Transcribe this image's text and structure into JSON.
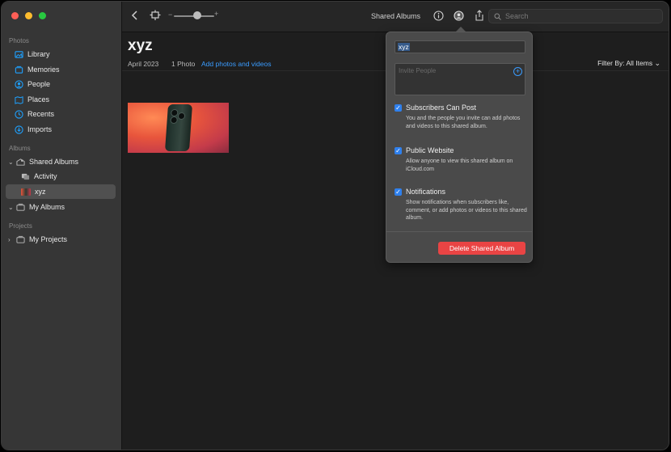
{
  "sidebar": {
    "sections": [
      {
        "title": "Photos"
      },
      {
        "title": "Albums"
      },
      {
        "title": "Projects"
      }
    ],
    "items": [
      {
        "label": "Library"
      },
      {
        "label": "Memories"
      },
      {
        "label": "People"
      },
      {
        "label": "Places"
      },
      {
        "label": "Recents"
      },
      {
        "label": "Imports"
      },
      {
        "label": "Shared Albums"
      },
      {
        "label": "Activity"
      },
      {
        "label": "xyz"
      },
      {
        "label": "My Albums"
      },
      {
        "label": "My Projects"
      }
    ]
  },
  "toolbar": {
    "mode_label": "Shared Albums",
    "search_placeholder": "Search",
    "zoom_minus": "−",
    "zoom_plus": "+"
  },
  "main": {
    "album_title": "xyz",
    "date": "April 2023",
    "count": "1 Photo",
    "add_link": "Add photos and videos",
    "filter": "Filter By: All Items"
  },
  "popover": {
    "album_name": "xyz",
    "invite_placeholder": "Invite People",
    "options": [
      {
        "title": "Subscribers Can Post",
        "desc": "You and the people you invite can add photos and videos to this shared album.",
        "checked": true
      },
      {
        "title": "Public Website",
        "desc": "Allow anyone to view this shared album on iCloud.com",
        "checked": true
      },
      {
        "title": "Notifications",
        "desc": "Show notifications when subscribers like, comment, or add photos or videos to this shared album.",
        "checked": true
      }
    ],
    "delete_label": "Delete Shared Album"
  },
  "colors": {
    "accent": "#3a9cff",
    "danger": "#e94444",
    "sidebar_bg": "#363636",
    "content_bg": "#1e1e1e"
  }
}
